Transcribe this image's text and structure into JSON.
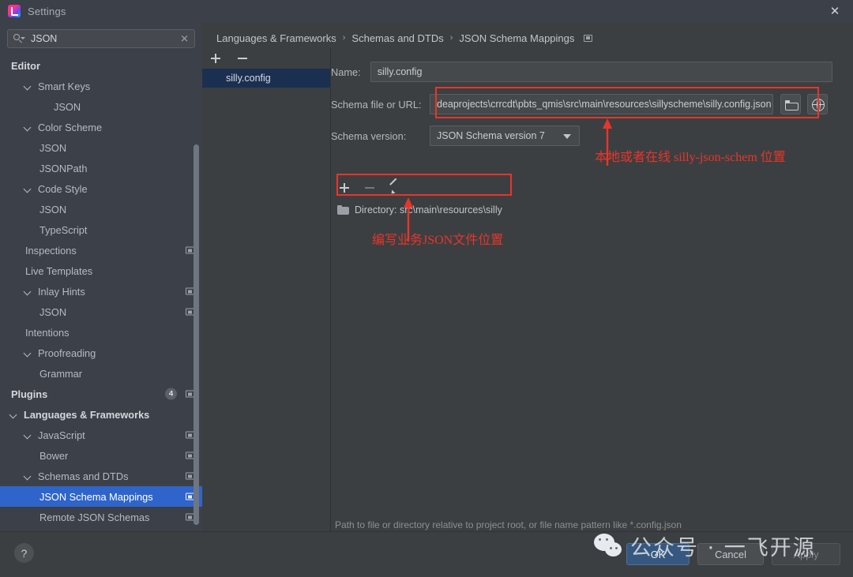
{
  "window": {
    "title": "Settings",
    "app_icon": "intellij-idea-icon",
    "close_label": "✕"
  },
  "search": {
    "value": "JSON",
    "placeholder": "Search settings",
    "icon": "search-icon",
    "clear_label": "✕"
  },
  "sidebar": {
    "items": [
      {
        "label": "Editor",
        "indent": 0,
        "bold": true,
        "twisty": false,
        "copy": false
      },
      {
        "label": "Smart Keys",
        "indent": 1,
        "bold": false,
        "twisty": true,
        "copy": false
      },
      {
        "label": "JSON",
        "indent": 3,
        "bold": false,
        "twisty": false,
        "copy": false
      },
      {
        "label": "Color Scheme",
        "indent": 1,
        "bold": false,
        "twisty": true,
        "copy": false
      },
      {
        "label": "JSON",
        "indent": 2,
        "bold": false,
        "twisty": false,
        "copy": false
      },
      {
        "label": "JSONPath",
        "indent": 2,
        "bold": false,
        "twisty": false,
        "copy": false
      },
      {
        "label": "Code Style",
        "indent": 1,
        "bold": false,
        "twisty": true,
        "copy": false
      },
      {
        "label": "JSON",
        "indent": 2,
        "bold": false,
        "twisty": false,
        "copy": false
      },
      {
        "label": "TypeScript",
        "indent": 2,
        "bold": false,
        "twisty": false,
        "copy": false
      },
      {
        "label": "Inspections",
        "indent": 1,
        "bold": false,
        "twisty": false,
        "copy": true
      },
      {
        "label": "Live Templates",
        "indent": 1,
        "bold": false,
        "twisty": false,
        "copy": false
      },
      {
        "label": "Inlay Hints",
        "indent": 1,
        "bold": false,
        "twisty": true,
        "copy": true
      },
      {
        "label": "JSON",
        "indent": 2,
        "bold": false,
        "twisty": false,
        "copy": true
      },
      {
        "label": "Intentions",
        "indent": 1,
        "bold": false,
        "twisty": false,
        "copy": false
      },
      {
        "label": "Proofreading",
        "indent": 1,
        "bold": false,
        "twisty": true,
        "copy": false
      },
      {
        "label": "Grammar",
        "indent": 2,
        "bold": false,
        "twisty": false,
        "copy": false
      },
      {
        "label": "Plugins",
        "indent": 0,
        "bold": true,
        "twisty": false,
        "copy": true,
        "count": "4"
      },
      {
        "label": "Languages & Frameworks",
        "indent": 0,
        "bold": true,
        "twisty": true,
        "copy": false
      },
      {
        "label": "JavaScript",
        "indent": 1,
        "bold": false,
        "twisty": true,
        "copy": true
      },
      {
        "label": "Bower",
        "indent": 2,
        "bold": false,
        "twisty": false,
        "copy": true
      },
      {
        "label": "Schemas and DTDs",
        "indent": 1,
        "bold": false,
        "twisty": true,
        "copy": true
      },
      {
        "label": "JSON Schema Mappings",
        "indent": 2,
        "bold": false,
        "twisty": false,
        "copy": true,
        "selected": true
      },
      {
        "label": "Remote JSON Schemas",
        "indent": 2,
        "bold": false,
        "twisty": false,
        "copy": true
      }
    ]
  },
  "breadcrumb": {
    "separator": "›",
    "parts": [
      "Languages & Frameworks",
      "Schemas and DTDs",
      "JSON Schema Mappings"
    ],
    "copy_icon": "copy-icon"
  },
  "mappings_list": {
    "add_label": "+",
    "remove_label": "−",
    "items": [
      {
        "label": "silly.config",
        "selected": true
      }
    ]
  },
  "detail": {
    "name_label": "Name:",
    "name_value": "silly.config",
    "schema_file_label": "Schema file or URL:",
    "schema_file_value": "deaprojects\\crrcdt\\pbts_qmis\\src\\main\\resources\\sillyscheme\\silly.config.json",
    "browse_icon": "folder-open-icon",
    "web_icon": "globe-icon",
    "schema_version_label": "Schema version:",
    "schema_version_value": "JSON Schema version 7",
    "patterns_toolbar": {
      "add_label": "+",
      "remove_label": "−",
      "edit_icon": "pencil-icon"
    },
    "patterns": [
      {
        "icon": "directory-icon",
        "label": "Directory: src\\main\\resources\\silly"
      }
    ],
    "hint": "Path to file or directory relative to project root, or file name pattern like *.config.json"
  },
  "annotations": [
    {
      "text": "本地或者在线 silly-json-schem 位置"
    },
    {
      "text": "编写业务JSON文件位置"
    }
  ],
  "footer": {
    "help_label": "?",
    "ok_label": "OK",
    "cancel_label": "Cancel",
    "apply_label": "Apply"
  },
  "watermark": {
    "text": "公众号 · 一飞开源",
    "logo": "wechat-icon"
  },
  "colors": {
    "accent_selection": "#2f65ca",
    "annotation_red": "#e8352a",
    "ok_button": "#365880"
  }
}
